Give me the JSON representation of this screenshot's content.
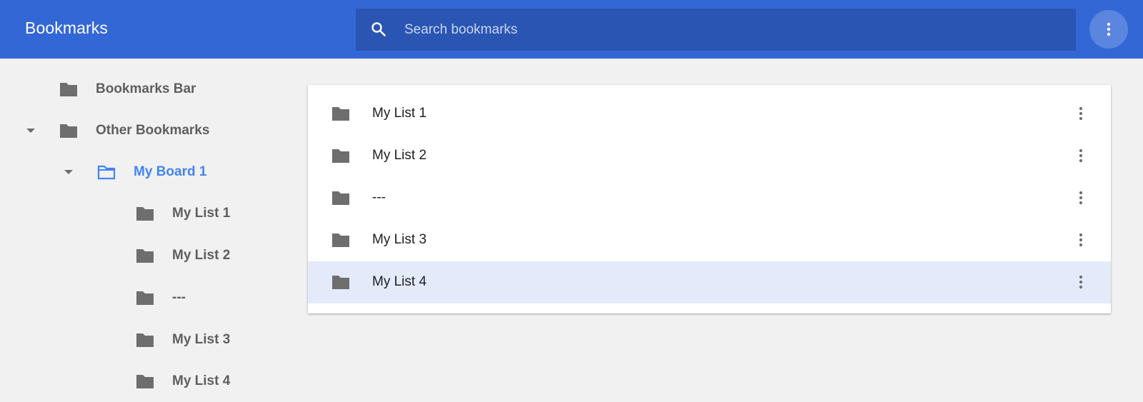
{
  "header": {
    "title": "Bookmarks",
    "search_placeholder": "Search bookmarks",
    "search_value": "",
    "menu_icon": "more-vertical-icon"
  },
  "sidebar": {
    "items": [
      {
        "label": "Bookmarks Bar",
        "icon": "folder-icon",
        "expanded": false,
        "selected": false
      },
      {
        "label": "Other Bookmarks",
        "icon": "folder-icon",
        "expanded": true,
        "selected": false
      },
      {
        "label": "My Board 1",
        "icon": "folder-open-icon",
        "expanded": true,
        "selected": true
      },
      {
        "label": "My List 1",
        "icon": "folder-icon",
        "selected": false
      },
      {
        "label": "My List 2",
        "icon": "folder-icon",
        "selected": false
      },
      {
        "label": "---",
        "icon": "folder-icon",
        "selected": false
      },
      {
        "label": "My List 3",
        "icon": "folder-icon",
        "selected": false
      },
      {
        "label": "My List 4",
        "icon": "folder-icon",
        "selected": false
      }
    ]
  },
  "main": {
    "rows": [
      {
        "label": "My List 1",
        "highlighted": false
      },
      {
        "label": "My List 2",
        "highlighted": false
      },
      {
        "label": "---",
        "highlighted": false
      },
      {
        "label": "My List 3",
        "highlighted": false
      },
      {
        "label": "My List 4",
        "highlighted": true
      }
    ]
  },
  "colors": {
    "header_bg": "#3367d6",
    "search_bg": "#2a55b3",
    "selected_text": "#4285f4",
    "row_highlight": "#e3ebfb"
  }
}
